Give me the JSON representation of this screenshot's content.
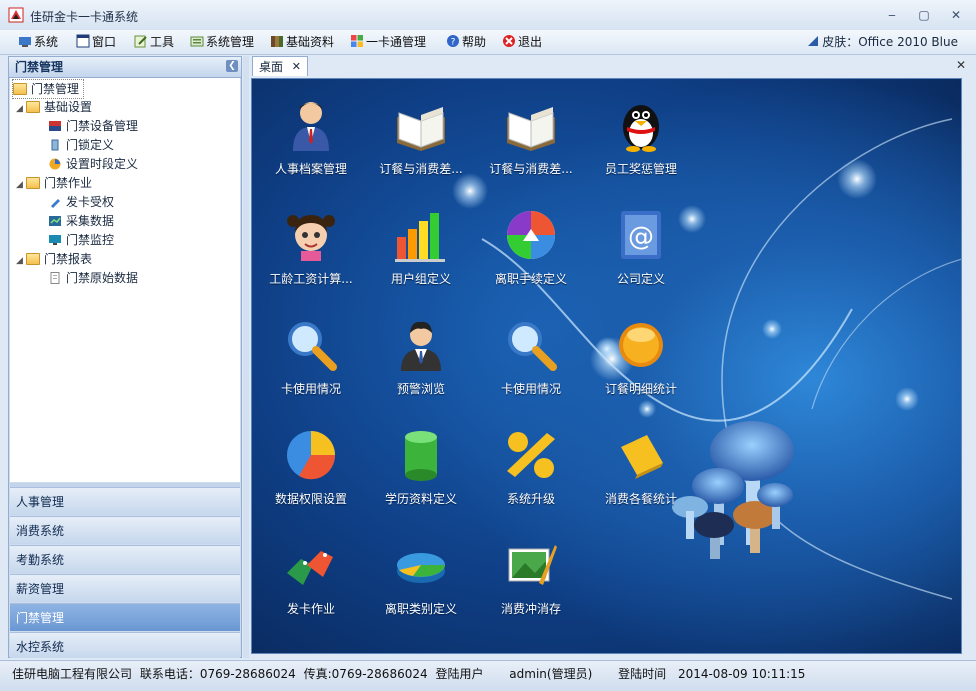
{
  "window": {
    "title": "佳研金卡一卡通系统"
  },
  "menubar": {
    "items": [
      {
        "label": "系统",
        "icon": "system-icon"
      },
      {
        "label": "窗口",
        "icon": "window-icon"
      },
      {
        "label": "工具",
        "icon": "tools-icon"
      },
      {
        "label": "系统管理",
        "icon": "system-admin-icon"
      },
      {
        "label": "基础资料",
        "icon": "basic-data-icon"
      },
      {
        "label": "一卡通管理",
        "icon": "card-management-icon"
      },
      {
        "label": "帮助",
        "icon": "help-icon"
      },
      {
        "label": "退出",
        "icon": "exit-icon"
      }
    ],
    "skin_label": "皮肤：Office 2010 Blue"
  },
  "left_panel": {
    "title": "门禁管理",
    "tree": {
      "root": "门禁管理",
      "groups": [
        {
          "label": "基础设置",
          "items": [
            "门禁设备管理",
            "门锁定义",
            "设置时段定义"
          ]
        },
        {
          "label": "门禁作业",
          "items": [
            "发卡受权",
            "采集数据",
            "门禁监控"
          ]
        },
        {
          "label": "门禁报表",
          "items": [
            "门禁原始数据"
          ]
        }
      ]
    },
    "nav": [
      "人事管理",
      "消费系统",
      "考勤系统",
      "薪资管理",
      "门禁管理",
      "水控系统"
    ],
    "active_nav": "门禁管理"
  },
  "tabs": [
    {
      "label": "桌面"
    }
  ],
  "desktop": {
    "icons": [
      {
        "label": "人事档案管理",
        "icon": "person-icon"
      },
      {
        "label": "订餐与消费差...",
        "icon": "book-icon"
      },
      {
        "label": "订餐与消费差...",
        "icon": "book-icon"
      },
      {
        "label": "员工奖惩管理",
        "icon": "penguin-icon"
      },
      {
        "label": "工龄工资计算...",
        "icon": "girl-avatar-icon"
      },
      {
        "label": "用户组定义",
        "icon": "bar-chart-icon"
      },
      {
        "label": "离职手续定义",
        "icon": "picasa-icon"
      },
      {
        "label": "公司定义",
        "icon": "address-book-icon"
      },
      {
        "label": "卡使用情况",
        "icon": "magnifier-icon"
      },
      {
        "label": "预警浏览",
        "icon": "businessman-icon"
      },
      {
        "label": "卡使用情况",
        "icon": "magnifier-icon"
      },
      {
        "label": "订餐明细统计",
        "icon": "orange-orb-icon"
      },
      {
        "label": "数据权限设置",
        "icon": "pie-chart-icon"
      },
      {
        "label": "学历资料定义",
        "icon": "green-cylinder-icon"
      },
      {
        "label": "系统升级",
        "icon": "percent-icon"
      },
      {
        "label": "消费各餐统计",
        "icon": "note-icon"
      },
      {
        "label": "发卡作业",
        "icon": "sale-tags-icon"
      },
      {
        "label": "离职类别定义",
        "icon": "pie-3d-icon"
      },
      {
        "label": "消费冲消存",
        "icon": "photo-edit-icon"
      }
    ]
  },
  "statusbar": {
    "company": "佳研电脑工程有限公司",
    "phone": "联系电话：0769-28686024",
    "fax": "传真:0769-28686024",
    "user_label": "登陆用户",
    "user": "admin(管理员)",
    "login_time_label": "登陆时间",
    "login_time": "2014-08-09 10:11:15"
  }
}
